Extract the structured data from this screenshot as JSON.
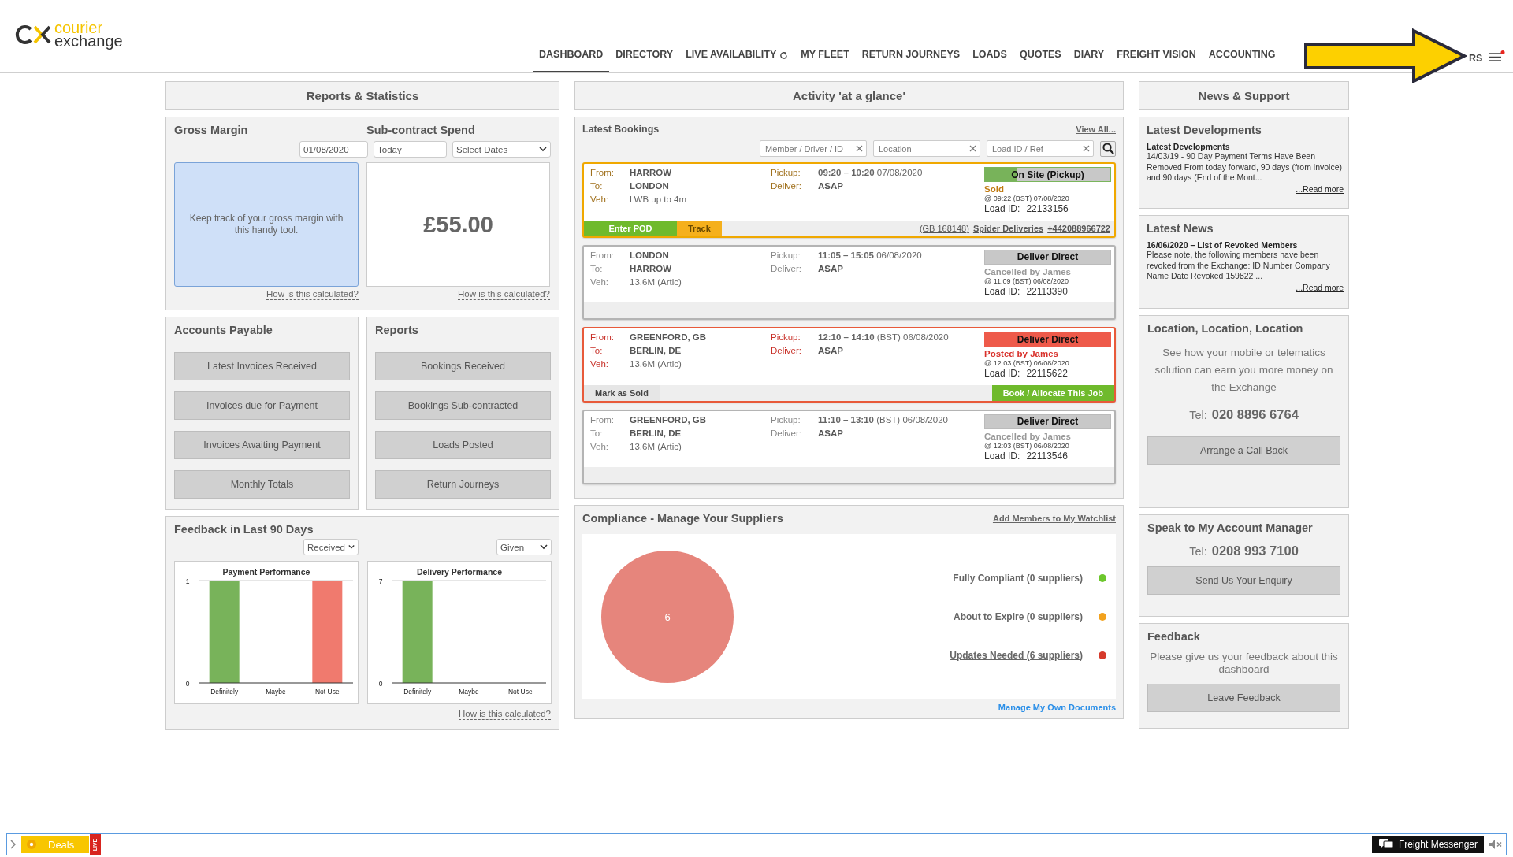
{
  "header": {
    "logo": {
      "line1": "courier",
      "line2": "exchange"
    },
    "nav": [
      {
        "label": "DASHBOARD",
        "selected": true,
        "refresh": false
      },
      {
        "label": "DIRECTORY",
        "selected": false,
        "refresh": false
      },
      {
        "label": "LIVE AVAILABILITY",
        "selected": false,
        "refresh": true
      },
      {
        "label": "MY FLEET",
        "selected": false,
        "refresh": false
      },
      {
        "label": "RETURN JOURNEYS",
        "selected": false,
        "refresh": false
      },
      {
        "label": "LOADS",
        "selected": false,
        "refresh": false
      },
      {
        "label": "QUOTES",
        "selected": false,
        "refresh": false
      },
      {
        "label": "DIARY",
        "selected": false,
        "refresh": false
      },
      {
        "label": "FREIGHT VISION",
        "selected": false,
        "refresh": false
      },
      {
        "label": "ACCOUNTING",
        "selected": false,
        "refresh": false
      }
    ],
    "partial_item": "RS",
    "alert": true
  },
  "reports": {
    "title": "Reports & Statistics",
    "gross_margin": {
      "title": "Gross Margin",
      "message": "Keep track of your gross margin with this handy tool.",
      "help": "How is this calculated?"
    },
    "subcontract": {
      "title": "Sub-contract Spend",
      "date_from": "01/08/2020",
      "date_to": "Today",
      "range": "Select Dates",
      "amount": "£55.00",
      "help": "How is this calculated?"
    },
    "accounts_payable": {
      "title": "Accounts Payable",
      "buttons": [
        "Latest Invoices Received",
        "Invoices due for Payment",
        "Invoices Awaiting Payment",
        "Monthly Totals"
      ]
    },
    "reports_list": {
      "title": "Reports",
      "buttons": [
        "Bookings Received",
        "Bookings Sub-contracted",
        "Loads Posted",
        "Return Journeys"
      ]
    },
    "feedback": {
      "title": "Feedback in Last 90 Days",
      "filters": [
        "Received",
        "Given"
      ],
      "help": "How is this calculated?",
      "charts": [
        {
          "chart_data": {
            "type": "bar",
            "title": "Payment Performance",
            "categories": [
              "Definitely",
              "Maybe",
              "Not Use"
            ],
            "stacked": true,
            "ylim": [
              0,
              1
            ],
            "yticks": [
              0,
              1
            ],
            "series": [
              {
                "color": "#78b35a",
                "values": [
                  1,
                  null,
                  null
                ]
              },
              {
                "color": "#f07a6e",
                "values": [
                  null,
                  null,
                  1
                ]
              }
            ]
          }
        },
        {
          "chart_data": {
            "type": "bar",
            "title": "Delivery Performance",
            "categories": [
              "Definitely",
              "Maybe",
              "Not Use"
            ],
            "stacked": true,
            "ylim": [
              0,
              7
            ],
            "yticks": [
              0,
              7
            ],
            "series": [
              {
                "color": "#78b35a",
                "values": [
                  7,
                  null,
                  null
                ]
              }
            ]
          }
        }
      ]
    }
  },
  "activity": {
    "title": "Activity 'at a glance'",
    "bookings": {
      "title": "Latest Bookings",
      "view_all": "View All...",
      "filters": [
        {
          "placeholder": "Member / Driver / ID"
        },
        {
          "placeholder": "Location"
        },
        {
          "placeholder": "Load ID / Ref"
        }
      ],
      "cards": [
        {
          "kind": "active",
          "rows": [
            {
              "label": "From:",
              "value": "HARROW",
              "bold": true
            },
            {
              "label": "To:",
              "value": "LONDON",
              "bold": true
            },
            {
              "label": "Veh:",
              "value": "LWB up to 4m",
              "bold": false
            }
          ],
          "times": [
            {
              "label": "Pickup:",
              "value": "**09:20 – 10:20** 07/08/2020",
              "bold": false
            },
            {
              "label": "Deliver:",
              "value": "ASAP",
              "bold": true
            }
          ],
          "badge": {
            "text": "On Site (Pickup)",
            "level": 0.25
          },
          "state_text": "Sold",
          "stamp": "@ 09:22 (BST) 07/08/2020",
          "load_label": "Load ID:",
          "load_id": "22133156",
          "actions": [
            {
              "label": "Enter POD",
              "kind": "go"
            },
            {
              "label": "Track",
              "kind": "track"
            }
          ],
          "contact": [
            {
              "text": "(GB 168148)",
              "bold": false
            },
            {
              "text": "Spider Deliveries",
              "bold": true
            },
            {
              "text": "+442088966722",
              "bold": true
            }
          ]
        },
        {
          "kind": "cancelled",
          "rows": [
            {
              "label": "From:",
              "value": "LONDON",
              "bold": true
            },
            {
              "label": "To:",
              "value": "HARROW",
              "bold": true
            },
            {
              "label": "Veh:",
              "value": "13.6M (Artic)",
              "bold": false
            }
          ],
          "times": [
            {
              "label": "Pickup:",
              "value": "**11:05 – 15:05** 06/08/2020",
              "bold": false
            },
            {
              "label": "Deliver:",
              "value": "ASAP",
              "bold": true
            }
          ],
          "badge": {
            "text": "Deliver Direct"
          },
          "state_text": "Cancelled by James",
          "stamp": "@ 11:09 (BST) 06/08/2020",
          "load_label": "Load ID:",
          "load_id": "22113390"
        },
        {
          "kind": "posted",
          "rows": [
            {
              "label": "From:",
              "value": "GREENFORD, GB",
              "bold": true
            },
            {
              "label": "To:",
              "value": "BERLIN, DE",
              "bold": true
            },
            {
              "label": "Veh:",
              "value": "13.6M (Artic)",
              "bold": false
            }
          ],
          "times": [
            {
              "label": "Pickup:",
              "value": "**12:10 – 14:10** (BST) 06/08/2020",
              "bold": false
            },
            {
              "label": "Deliver:",
              "value": "ASAP",
              "bold": true
            }
          ],
          "badge": {
            "text": "Deliver Direct"
          },
          "state_text": "Posted by James",
          "stamp": "@ 12:03 (BST) 06/08/2020",
          "load_label": "Load ID:",
          "load_id": "22115622",
          "actions": [
            {
              "label": "Mark as Sold",
              "kind": "plain"
            }
          ],
          "end_actions": [
            {
              "label": "Book / Allocate This Job",
              "kind": "go"
            }
          ]
        },
        {
          "kind": "cancelled",
          "rows": [
            {
              "label": "From:",
              "value": "GREENFORD, GB",
              "bold": true
            },
            {
              "label": "To:",
              "value": "BERLIN, DE",
              "bold": true
            },
            {
              "label": "Veh:",
              "value": "13.6M (Artic)",
              "bold": false
            }
          ],
          "times": [
            {
              "label": "Pickup:",
              "value": "**11:10 – 13:10** (BST) 06/08/2020",
              "bold": false
            },
            {
              "label": "Deliver:",
              "value": "ASAP",
              "bold": true
            }
          ],
          "badge": {
            "text": "Deliver Direct"
          },
          "state_text": "Cancelled by James",
          "stamp": "@ 12:03 (BST) 06/08/2020",
          "load_label": "Load ID:",
          "load_id": "22113546"
        }
      ]
    },
    "compliance": {
      "title": "Compliance - Manage Your Suppliers",
      "watchlist": "Add Members to My Watchlist",
      "legend": [
        {
          "label": "Fully Compliant (0 suppliers)",
          "color": "#6cc72c",
          "link": false
        },
        {
          "label": "About to Expire (0 suppliers)",
          "color": "#f2a21e",
          "link": false
        },
        {
          "label": "Updates Needed (6 suppliers)",
          "color": "#d63a2c",
          "link": true
        }
      ],
      "chart_data": {
        "type": "pie",
        "values": [
          0,
          0,
          6
        ],
        "data_labels": true
      },
      "documents": "Manage My Own Documents"
    }
  },
  "news": {
    "title": "News & Support",
    "items": [
      {
        "title": "Latest Developments",
        "headline": "Latest Developments",
        "body": "14/03/19 - 90 Day Payment Terms Have Been Removed From today forward, 90 days (from invoice) and 90 days (End of the Mont...",
        "more": "...Read more"
      },
      {
        "title": "Latest News",
        "headline": "16/06/2020 – List of Revoked Members",
        "body": "Please note, the following members have been revoked from the Exchange: ID Number Company Name Date Revoked 159822 ...",
        "more": "...Read more"
      }
    ],
    "location": {
      "title": "Location, Location, Location",
      "text": "See how your mobile or telematics solution can earn you more money on the Exchange",
      "tel_label": "Tel:",
      "tel": "020 8896 6764",
      "button": "Arrange a Call Back"
    },
    "manager": {
      "title": "Speak to My Account Manager",
      "tel_label": "Tel:",
      "tel": "0208 993 7100",
      "button": "Send Us Your Enquiry"
    },
    "feedback": {
      "title": "Feedback",
      "text": "Please give us your feedback about this dashboard",
      "button": "Leave Feedback"
    }
  },
  "footer_bar": {
    "deals": "Deals",
    "live": "LIVE",
    "messenger": "Freight Messenger",
    "muted": true
  }
}
